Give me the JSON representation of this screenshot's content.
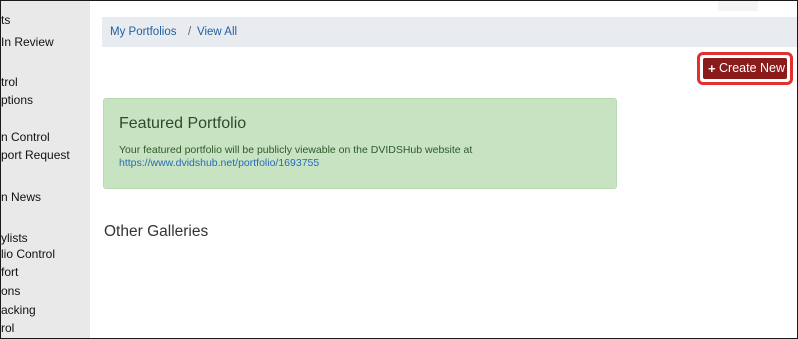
{
  "sidebar": {
    "items": [
      {
        "label": "ts"
      },
      {
        "label": " In Review"
      },
      {
        "label": "trol"
      },
      {
        "label": "ptions"
      },
      {
        "label": "n Control"
      },
      {
        "label": "port Request"
      },
      {
        "label": "n News"
      },
      {
        "label": "ylists"
      },
      {
        "label": "lio Control"
      },
      {
        "label": "fort"
      },
      {
        "label": "ons"
      },
      {
        "label": "acking"
      },
      {
        "label": "rol"
      }
    ]
  },
  "breadcrumb": {
    "items": [
      "My Portfolios",
      "View All"
    ],
    "separator": "/"
  },
  "toolbar": {
    "create_icon": "plus-icon",
    "create_label": "Create New"
  },
  "featured": {
    "title": "Featured Portfolio",
    "text": "Your featured portfolio will be publicly viewable on the DVIDSHub website at",
    "link": "https://www.dvidshub.net/portfolio/1693755"
  },
  "other": {
    "title": "Other Galleries"
  },
  "colors": {
    "create_button": "#8b1a1a",
    "highlight_border": "#e03030",
    "featured_bg": "#c7e3c2",
    "link": "#2a6cb5",
    "breadcrumb_bg": "#e8ecf0",
    "sidebar_bg": "#e9e9e9"
  }
}
